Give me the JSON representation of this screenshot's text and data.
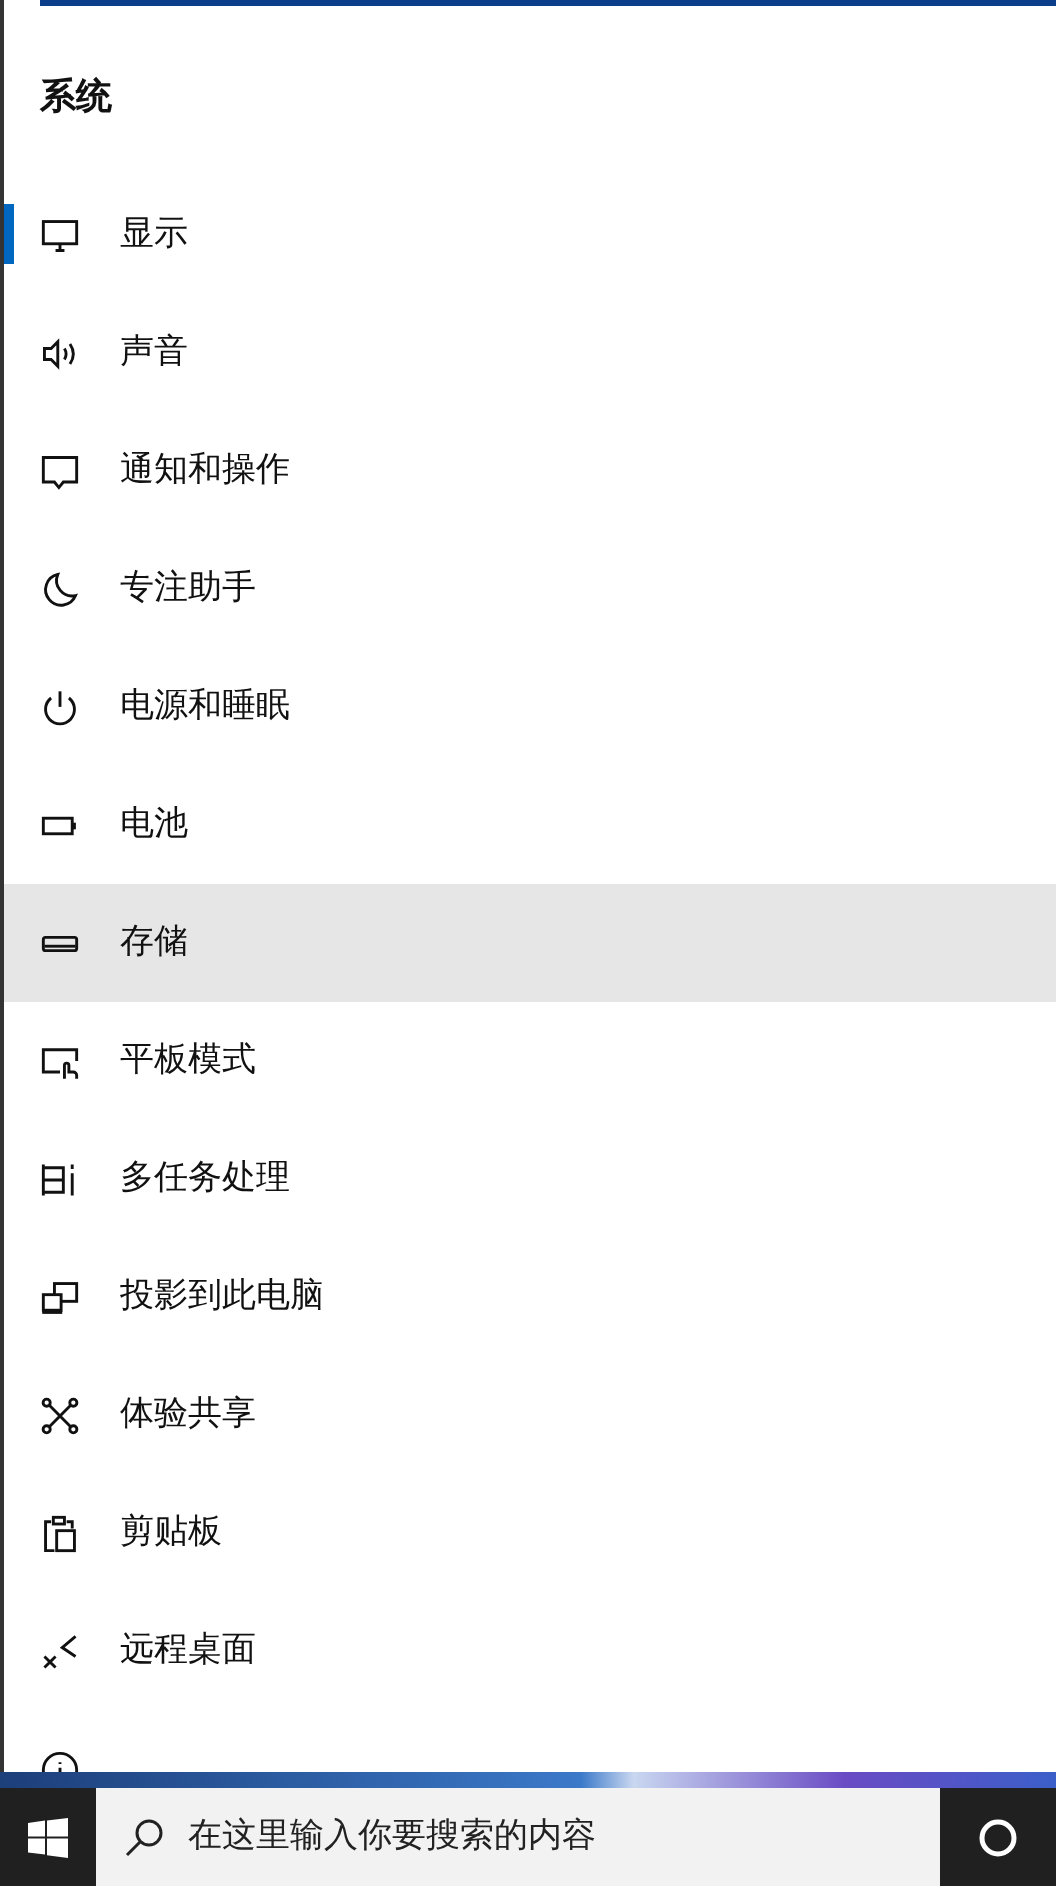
{
  "section_title": "系统",
  "nav_items": [
    {
      "label": "显示",
      "kind": "display",
      "selected": true,
      "hovered": false
    },
    {
      "label": "声音",
      "kind": "sound",
      "selected": false,
      "hovered": false
    },
    {
      "label": "通知和操作",
      "kind": "notification",
      "selected": false,
      "hovered": false
    },
    {
      "label": "专注助手",
      "kind": "moon",
      "selected": false,
      "hovered": false
    },
    {
      "label": "电源和睡眠",
      "kind": "power",
      "selected": false,
      "hovered": false
    },
    {
      "label": "电池",
      "kind": "battery",
      "selected": false,
      "hovered": false
    },
    {
      "label": "存储",
      "kind": "storage",
      "selected": false,
      "hovered": true
    },
    {
      "label": "平板模式",
      "kind": "tablet",
      "selected": false,
      "hovered": false
    },
    {
      "label": "多任务处理",
      "kind": "multitask",
      "selected": false,
      "hovered": false
    },
    {
      "label": "投影到此电脑",
      "kind": "project",
      "selected": false,
      "hovered": false
    },
    {
      "label": "体验共享",
      "kind": "share",
      "selected": false,
      "hovered": false
    },
    {
      "label": "剪贴板",
      "kind": "clipboard",
      "selected": false,
      "hovered": false
    },
    {
      "label": "远程桌面",
      "kind": "remote",
      "selected": false,
      "hovered": false
    },
    {
      "kind": "info",
      "selected": false,
      "hovered": false
    }
  ],
  "taskbar": {
    "search": {
      "placeholder": "在这里输入你要搜索的内容"
    }
  }
}
